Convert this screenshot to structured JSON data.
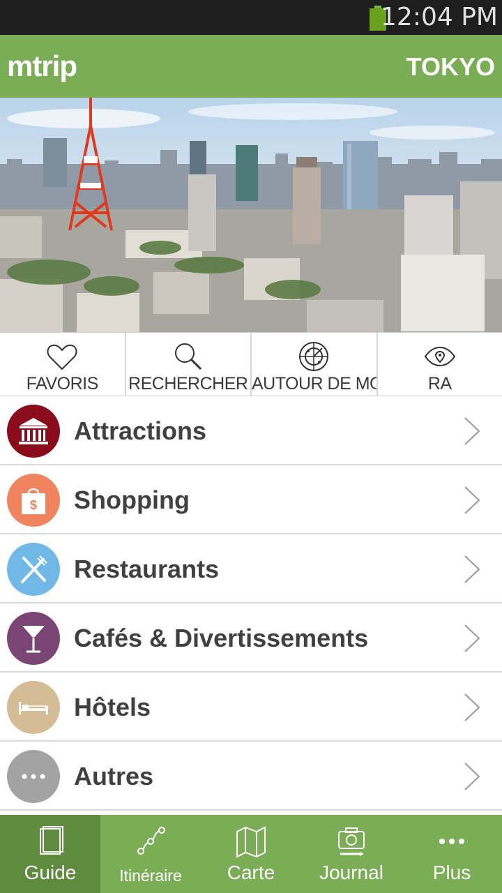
{
  "status_bar": {
    "time": "12:04 PM",
    "battery_icon": "battery-icon"
  },
  "header": {
    "logo": "mtrip",
    "city": "TOKYO"
  },
  "hero": {
    "image": "tokyo-skyline-photo"
  },
  "quick_actions": [
    {
      "label": "FAVORIS",
      "icon": "heart-icon"
    },
    {
      "label": "RECHERCHER",
      "icon": "search-icon"
    },
    {
      "label": "AUTOUR DE MOI",
      "icon": "radar-icon"
    },
    {
      "label": "RA",
      "icon": "eye-icon"
    }
  ],
  "categories": [
    {
      "label": "Attractions",
      "icon": "museum-icon",
      "color": "#8a0c1c"
    },
    {
      "label": "Shopping",
      "icon": "shopping-bag-icon",
      "color": "#f0845f"
    },
    {
      "label": "Restaurants",
      "icon": "fork-knife-icon",
      "color": "#72b8e6"
    },
    {
      "label": "Cafés & Divertissements",
      "icon": "cocktail-icon",
      "color": "#7a4474"
    },
    {
      "label": "Hôtels",
      "icon": "bed-icon",
      "color": "#d4bc96"
    },
    {
      "label": "Autres",
      "icon": "more-dots-icon",
      "color": "#a3a3a3"
    }
  ],
  "bottom_nav": [
    {
      "label": "Guide",
      "icon": "book-icon",
      "active": true
    },
    {
      "label": "Itinéraire",
      "icon": "route-icon",
      "active": false
    },
    {
      "label": "Carte",
      "icon": "map-icon",
      "active": false
    },
    {
      "label": "Journal",
      "icon": "camera-icon",
      "active": false
    },
    {
      "label": "Plus",
      "icon": "more-icon",
      "active": false
    }
  ],
  "colors": {
    "brand_green": "#7aad55",
    "active_tab": "#5e8b3d",
    "status_bar": "#1e1e1e"
  }
}
